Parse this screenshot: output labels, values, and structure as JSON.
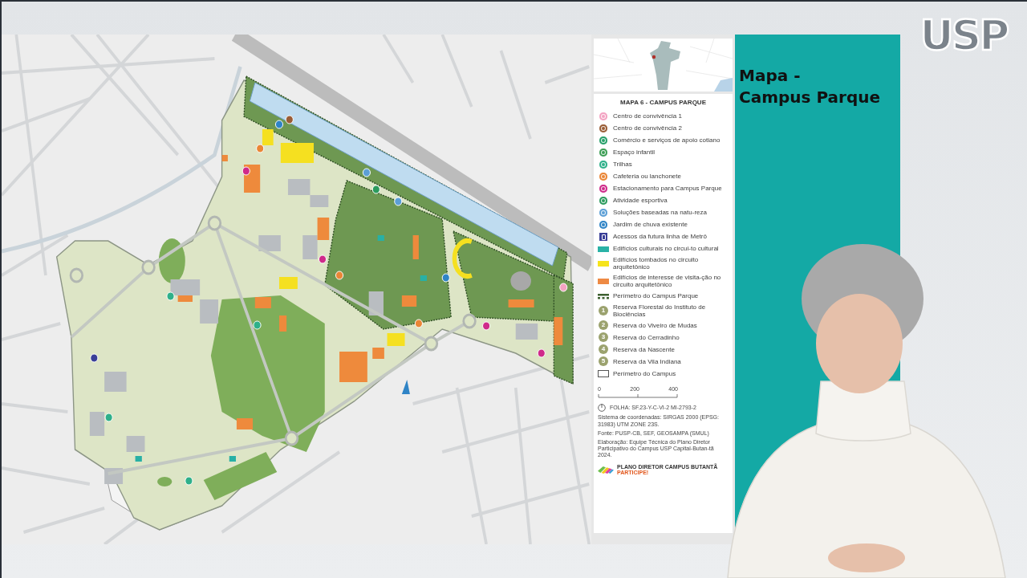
{
  "slide": {
    "legend": {
      "title": "MAPA 6 - CAMPUS PARQUE",
      "items": [
        {
          "kind": "marker",
          "color": "#f3a3c2",
          "label": "Centro de convivência 1"
        },
        {
          "kind": "marker",
          "color": "#9a5d36",
          "label": "Centro de convivência 2"
        },
        {
          "kind": "marker",
          "color": "#27a06a",
          "label": "Comércio e serviços de apoio cotiano"
        },
        {
          "kind": "marker",
          "color": "#3d9e55",
          "label": "Espaço infantil"
        },
        {
          "kind": "marker",
          "color": "#2fb08a",
          "label": "Trilhas"
        },
        {
          "kind": "marker",
          "color": "#ea8636",
          "label": "Cafeteria ou lanchonete"
        },
        {
          "kind": "marker",
          "color": "#cf2a8a",
          "label": "Estacionamento para Campus Parque"
        },
        {
          "kind": "marker",
          "color": "#2c9b5d",
          "label": "Atividade esportiva"
        },
        {
          "kind": "marker",
          "color": "#5c9fd6",
          "label": "Soluções baseadas na natu-reza"
        },
        {
          "kind": "marker",
          "color": "#2f84c6",
          "label": "Jardim de chuva existente"
        },
        {
          "kind": "metro",
          "color": "#3a3f98",
          "label": "Acessos da futura linha de Metrô"
        },
        {
          "kind": "swatch",
          "color": "#2ab2a6",
          "label": "Edifícios culturais no circui-to cultural"
        },
        {
          "kind": "swatch",
          "color": "#f6e41c",
          "label": "Edifícios tombados no circuito arquitetônico"
        },
        {
          "kind": "swatch",
          "color": "#ee8a44",
          "label": "Edifícios de interesse de visita-ção no circuito arquitetônico"
        },
        {
          "kind": "dotted-line",
          "color": "#3d6030",
          "label": "Perímetro do Campus Parque"
        },
        {
          "kind": "numbered",
          "number": "1",
          "color": "#9ba26e",
          "label": "Reserva Florestal do Instituto de Biociências"
        },
        {
          "kind": "numbered",
          "number": "2",
          "color": "#9ba26e",
          "label": "Reserva do Viveiro de Mudas"
        },
        {
          "kind": "numbered",
          "number": "3",
          "color": "#9ba26e",
          "label": "Reserva do Cerradinho"
        },
        {
          "kind": "numbered",
          "number": "4",
          "color": "#9ba26e",
          "label": "Reserva da Nascente"
        },
        {
          "kind": "numbered",
          "number": "5",
          "color": "#9ba26e",
          "label": "Reserva da Vila Indiana"
        },
        {
          "kind": "outline",
          "color": "#555555",
          "label": "Perímetro do Campus"
        }
      ]
    },
    "scale": [
      "0",
      "200",
      "400"
    ],
    "sheet": "FOLHA: SF.23-Y-C-VI-2 MI-2793-2",
    "notes": [
      "Sistema de coordenadas: SIRGAS 2000 (EPSG: 31983) UTM ZONE 23S.",
      "Fonte: PUSP-CB, SEF, GEOSAMPA (SMUL)",
      "Elaboração: Equipe Técnica do Plano Diretor Participativo do Campus USP Capital-Butan-tã 2024."
    ],
    "plan_logo": {
      "name": "PLANO DIRETOR CAMPUS BUTANTÃ",
      "tagline": "PARTICIPE!"
    },
    "title": "Mapa -\nCampus Parque"
  },
  "logo": {
    "text": "USP"
  }
}
